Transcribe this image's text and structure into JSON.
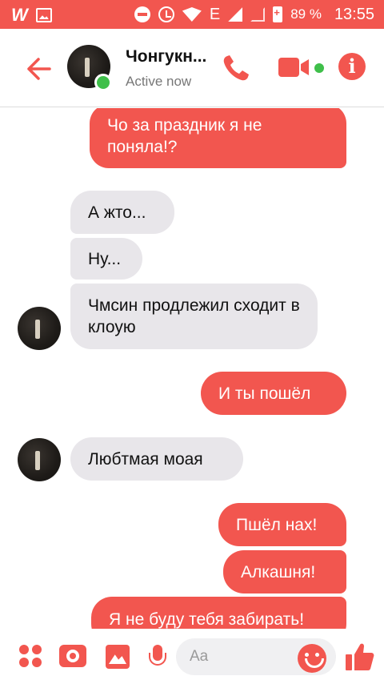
{
  "status_bar": {
    "battery": "89 %",
    "network": "E",
    "time": "13:55"
  },
  "header": {
    "contact_name": "Чонгукн...",
    "status": "Active now"
  },
  "messages": [
    {
      "direction": "outgoing",
      "text": "Чо за праздник я не поняла!?"
    },
    {
      "direction": "incoming",
      "text": "А жто..."
    },
    {
      "direction": "incoming",
      "text": "Ну..."
    },
    {
      "direction": "incoming",
      "text": "Чмсин продлежил сходит в клоую"
    },
    {
      "direction": "outgoing",
      "text": "И ты пошёл"
    },
    {
      "direction": "incoming",
      "text": "Любтмая моая"
    },
    {
      "direction": "outgoing",
      "text": "Пшёл нах!"
    },
    {
      "direction": "outgoing",
      "text": "Алкашня!"
    },
    {
      "direction": "outgoing",
      "text": "Я не буду тебя забирать!"
    }
  ],
  "composer": {
    "placeholder": "Aa"
  },
  "colors": {
    "accent": "#f2564f",
    "incoming_bubble": "#e8e6ea",
    "online": "#3fbf4a"
  }
}
